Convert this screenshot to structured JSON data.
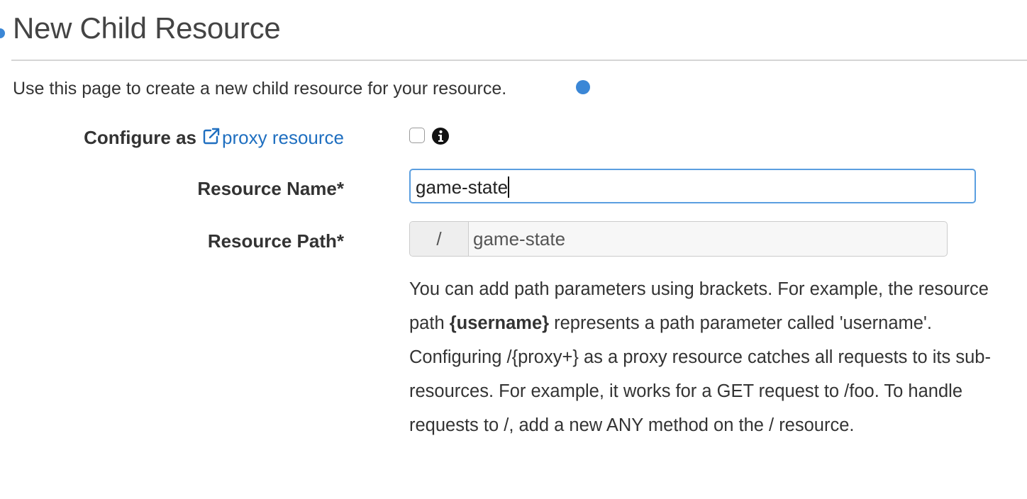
{
  "header": {
    "title": "New Child Resource",
    "intro": "Use this page to create a new child resource for your resource."
  },
  "form": {
    "proxy": {
      "label_prefix": "Configure as",
      "link_text": "proxy resource",
      "checked": false
    },
    "resource_name": {
      "label": "Resource Name*",
      "value": "game-state"
    },
    "resource_path": {
      "label": "Resource Path*",
      "prefix": "/",
      "value": "game-state"
    }
  },
  "help": {
    "part1": "You can add path parameters using brackets. For example, the resource path ",
    "bold": "{username}",
    "part2": " represents a path parameter called 'username'. Configuring /{proxy+} as a proxy resource catches all requests to its sub-resources. For example, it works for a GET request to /foo. To handle requests to /, add a new ANY method on the / resource."
  },
  "colors": {
    "accent": "#3b87d6",
    "link": "#1f6fc0",
    "focus_border": "#5b9fe0",
    "divider": "#d5d5d5"
  },
  "icons": [
    "help-dot-icon",
    "external-link-icon",
    "info-icon"
  ]
}
